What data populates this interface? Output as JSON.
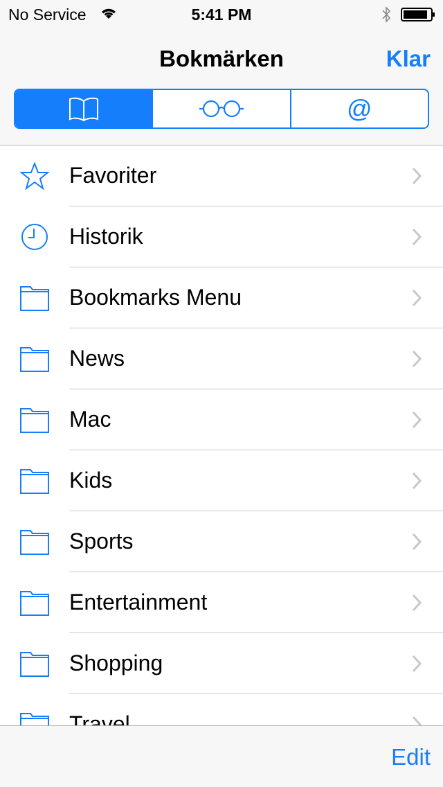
{
  "status": {
    "carrier": "No Service",
    "time": "5:41 PM"
  },
  "nav": {
    "title": "Bokmärken",
    "done_label": "Klar"
  },
  "segments": [
    {
      "icon": "book-icon",
      "selected": true
    },
    {
      "icon": "glasses-icon",
      "selected": false
    },
    {
      "icon": "at-icon",
      "selected": false
    }
  ],
  "items": [
    {
      "label": "Favoriter",
      "icon": "star-icon"
    },
    {
      "label": "Historik",
      "icon": "clock-icon"
    },
    {
      "label": "Bookmarks Menu",
      "icon": "folder-icon"
    },
    {
      "label": "News",
      "icon": "folder-icon"
    },
    {
      "label": "Mac",
      "icon": "folder-icon"
    },
    {
      "label": "Kids",
      "icon": "folder-icon"
    },
    {
      "label": "Sports",
      "icon": "folder-icon"
    },
    {
      "label": "Entertainment",
      "icon": "folder-icon"
    },
    {
      "label": "Shopping",
      "icon": "folder-icon"
    },
    {
      "label": "Travel",
      "icon": "folder-icon"
    }
  ],
  "toolbar": {
    "edit_label": "Edit"
  },
  "colors": {
    "accent": "#157efb"
  }
}
